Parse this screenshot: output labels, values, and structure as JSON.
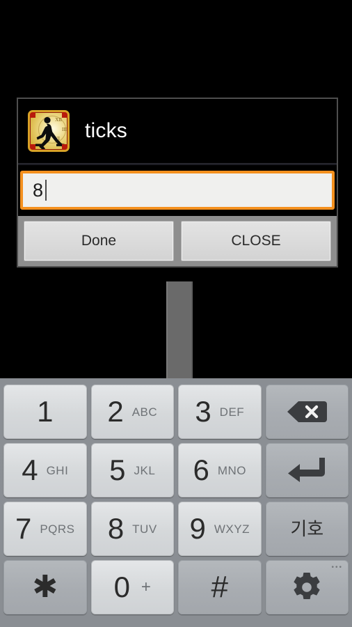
{
  "app_background_color": "#000000",
  "dialog": {
    "title": "ticks",
    "icon_name": "ticks-app-icon",
    "input": {
      "value": "8",
      "placeholder": "",
      "focus_color": "#f4901e"
    },
    "buttons": {
      "done_label": "Done",
      "close_label": "CLOSE"
    }
  },
  "keyboard": {
    "type": "numeric-phone-keypad",
    "background_color": "#8a8e93",
    "rows": [
      [
        {
          "name": "key-1",
          "digit": "1",
          "letters": "",
          "style": "light"
        },
        {
          "name": "key-2",
          "digit": "2",
          "letters": "ABC",
          "style": "light"
        },
        {
          "name": "key-3",
          "digit": "3",
          "letters": "DEF",
          "style": "light"
        },
        {
          "name": "key-backspace",
          "digit": "",
          "letters": "",
          "icon": "backspace-icon",
          "style": "dark"
        }
      ],
      [
        {
          "name": "key-4",
          "digit": "4",
          "letters": "GHI",
          "style": "light"
        },
        {
          "name": "key-5",
          "digit": "5",
          "letters": "JKL",
          "style": "light"
        },
        {
          "name": "key-6",
          "digit": "6",
          "letters": "MNO",
          "style": "light"
        },
        {
          "name": "key-enter",
          "digit": "",
          "letters": "",
          "icon": "enter-icon",
          "style": "dark"
        }
      ],
      [
        {
          "name": "key-7",
          "digit": "7",
          "letters": "PQRS",
          "style": "light"
        },
        {
          "name": "key-8",
          "digit": "8",
          "letters": "TUV",
          "style": "light"
        },
        {
          "name": "key-9",
          "digit": "9",
          "letters": "WXYZ",
          "style": "light"
        },
        {
          "name": "key-symbol",
          "digit": "",
          "letters": "",
          "hangul": "기호",
          "style": "dark"
        }
      ],
      [
        {
          "name": "key-asterisk",
          "glyph": "✱",
          "style": "dark"
        },
        {
          "name": "key-0",
          "digit": "0",
          "plus": "+",
          "style": "light"
        },
        {
          "name": "key-hash",
          "glyph": "#",
          "style": "dark"
        },
        {
          "name": "key-settings",
          "icon": "gear-icon",
          "dots": "•••",
          "style": "dark"
        }
      ]
    ]
  }
}
